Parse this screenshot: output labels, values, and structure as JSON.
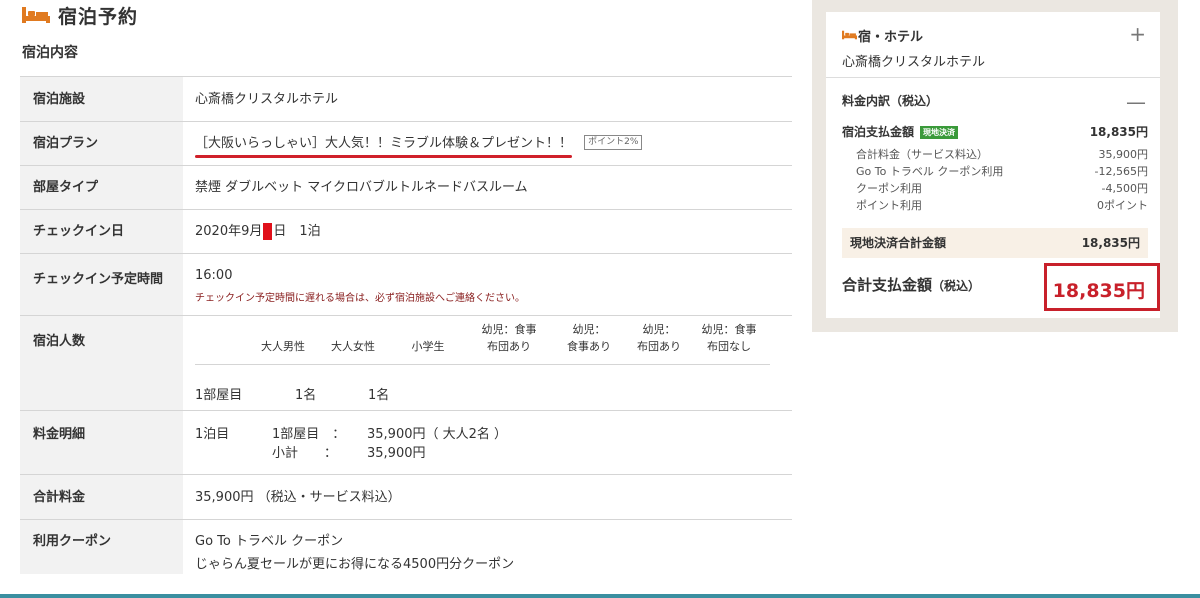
{
  "header": {
    "title": "宿泊予約",
    "subtitle": "宿泊内容"
  },
  "details": {
    "facility_label": "宿泊施設",
    "facility_value": "心斎橋クリスタルホテル",
    "plan_label": "宿泊プラン",
    "plan_value": "［大阪いらっしゃい］大人気！！ミラブル体験＆プレゼント！！",
    "plan_badge": "ポイント2%",
    "room_label": "部屋タイプ",
    "room_value": "禁煙 ダブルベット マイクロバブルトルネードバスルーム",
    "checkin_label": "チェックイン日",
    "checkin_value_prefix": "2020年9月",
    "checkin_value_suffix": "日　1泊",
    "checkin_time_label": "チェックイン予定時間",
    "checkin_time_value": "16:00",
    "checkin_time_note": "チェックイン予定時間に遅れる場合は、必ず宿泊施設へご連絡ください。",
    "guests_label": "宿泊人数",
    "guest_columns": [
      "大人男性",
      "大人女性",
      "小学生",
      "幼児：食事\n布団あり",
      "幼児：\n食事あり",
      "幼児：\n布団あり",
      "幼児：食事\n布団なし"
    ],
    "guest_room": "1部屋目",
    "guest_counts": [
      "1名",
      "1名"
    ],
    "price_detail_label": "料金明細",
    "price_night": "1泊目",
    "price_room": "1部屋目　：",
    "price_room_amount": "35,900円（ 大人2名 ）",
    "price_subtotal_label": "小計　　：",
    "price_subtotal": "35,900円",
    "total_label": "合計料金",
    "total_value": "35,900円 （税込・サービス料込）",
    "coupon_label": "利用クーポン",
    "coupon_line1": "Go To トラベル クーポン",
    "coupon_line2": "じゃらん夏セールが更にお得になる4500円分クーポン"
  },
  "summary": {
    "category": "宿・ホテル",
    "hotel": "心斎橋クリスタルホテル",
    "breakdown_title": "料金内訳（税込）",
    "pay_label": "宿泊支払金額",
    "pay_badge": "現地決済",
    "pay_amount": "18,835円",
    "lines": [
      {
        "label": "合計料金（サービス料込）",
        "value": "35,900円"
      },
      {
        "label": "Go To トラベル クーポン利用",
        "value": "-12,565円"
      },
      {
        "label": "クーポン利用",
        "value": "-4,500円"
      },
      {
        "label": "ポイント利用",
        "value": "0ポイント"
      }
    ],
    "onsite_label": "現地決済合計金額",
    "onsite_value": "18,835円",
    "grand_label": "合計支払金額",
    "grand_label_small": "（税込）",
    "grand_value": "18,835円",
    "plus": "+",
    "minus": "—"
  },
  "colors": {
    "accent_orange": "#e07a20",
    "highlight_red": "#c8202a",
    "badge_green": "#3a9a3a"
  }
}
